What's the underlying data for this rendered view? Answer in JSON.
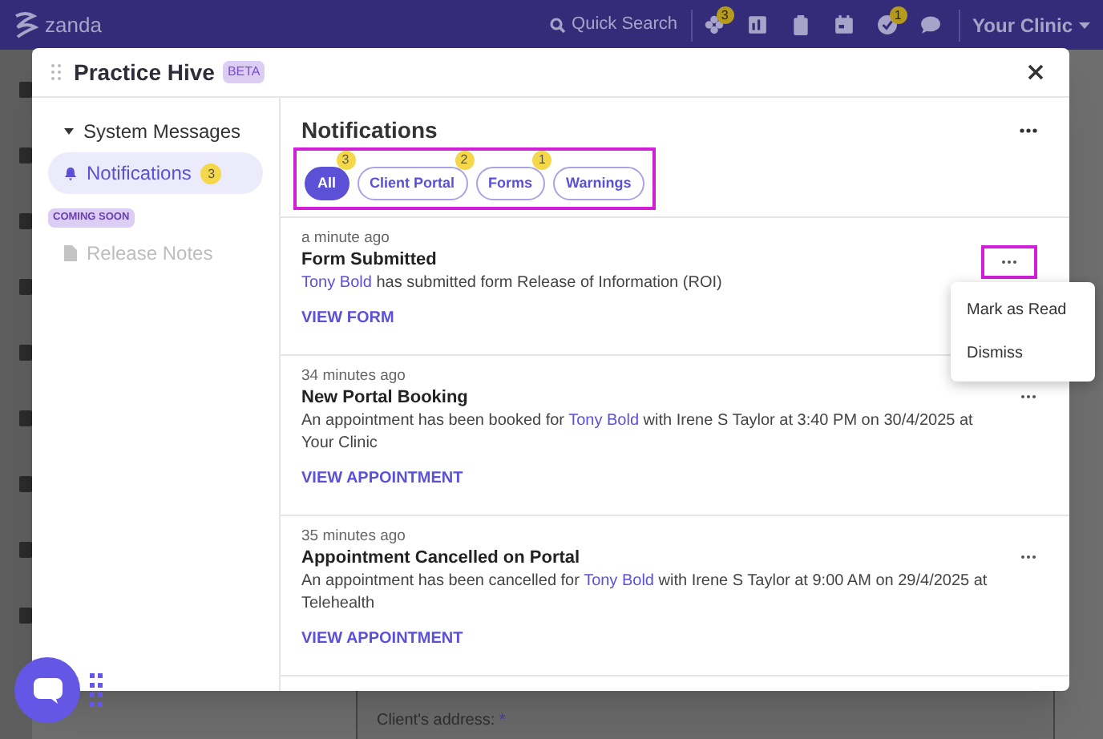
{
  "top_bar": {
    "logo": "zanda",
    "search": "Quick Search",
    "hive_badge": "3",
    "tasks_badge": "1",
    "clinic": "Your Clinic"
  },
  "background_form": {
    "label": "Client's address:",
    "required_mark": "*"
  },
  "modal": {
    "title": "Practice Hive",
    "badge": "BETA",
    "sidebar": {
      "group": "System Messages",
      "expanded": true,
      "items": [
        {
          "label": "Notifications",
          "count": "3",
          "selected": true,
          "disabled": false
        },
        {
          "label": "Release Notes",
          "tag": "COMING SOON",
          "selected": false,
          "disabled": true
        }
      ]
    },
    "panel_title": "Notifications",
    "filters": [
      {
        "label": "All",
        "count": "3",
        "selected": true
      },
      {
        "label": "Client Portal",
        "count": "2",
        "selected": false
      },
      {
        "label": "Forms",
        "count": "1",
        "selected": false
      },
      {
        "label": "Warnings",
        "selected": false
      }
    ],
    "notifications": [
      {
        "time": "a minute ago",
        "title": "Form Submitted",
        "client": "Tony Bold",
        "after": " has submitted form Release of Information (ROI)",
        "action": "VIEW FORM",
        "menu_open": true
      },
      {
        "time": "34 minutes ago",
        "title": "New Portal Booking",
        "before": "An appointment has been booked for ",
        "client": "Tony Bold",
        "after": " with Irene S Taylor at 3:40 PM on 30/4/2025 at Your Clinic",
        "action": "VIEW APPOINTMENT",
        "menu_open": false
      },
      {
        "time": "35 minutes ago",
        "title": "Appointment Cancelled on Portal",
        "before": "An appointment has been cancelled for ",
        "client": "Tony Bold",
        "after": " with Irene S Taylor at 9:00 AM on 29/4/2025 at Telehealth",
        "action": "VIEW APPOINTMENT",
        "menu_open": false
      }
    ],
    "menu": [
      "Mark as Read",
      "Dismiss"
    ]
  }
}
